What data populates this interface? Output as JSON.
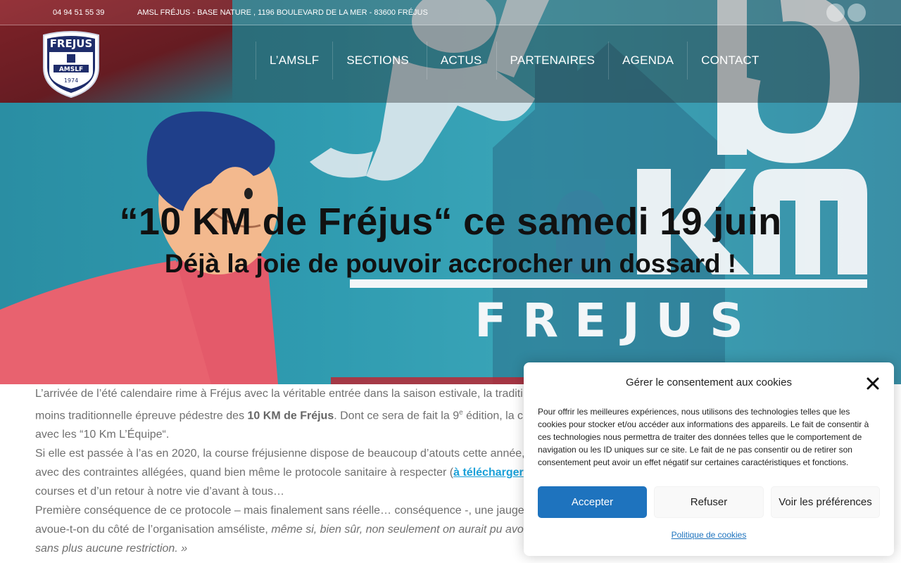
{
  "topbar": {
    "phone": "04 94 51 55 39",
    "address": "AMSL FRÉJUS - BASE NATURE , 1196 BOULEVARD DE LA MER - 83600 FRÉJUS"
  },
  "logo": {
    "top_text": "FREJUS",
    "mid_text": "AMSLF",
    "year": "1974"
  },
  "nav": {
    "items": [
      "L’AMSLF",
      "SECTIONS",
      "ACTUS",
      "PARTENAIRES",
      "AGENDA",
      "CONTACT"
    ]
  },
  "hero": {
    "title": "“10 KM de Fréjus“ ce samedi 19 juin",
    "subtitle": "Déjà la joie de pouvoir accrocher un dossard !",
    "poster_big": "10",
    "poster_km": "km",
    "poster_city": "F R E J U S"
  },
  "article": {
    "l1": "L’arrivée de l’été calendaire rime à Fréjus avec la véritable entrée dans la saison estivale, la traditi",
    "l2_a": "moins traditionnelle épreuve pédestre des ",
    "l2_b": "10 KM de Fréjus",
    "l2_c": ". Dont ce sera de fait la 9",
    "l2_sup": "e",
    "l2_d": " édition, la c",
    "l3": "avec les “10 Km L’Équipe“.",
    "l4": "Si elle est passée à l’as en 2020, la course fréjusienne dispose de beaucoup d’atouts cette année,",
    "l5_a": "avec des contraintes allégées, quand bien même le protocole sanitaire à respecter (",
    "l5_link": "à télécharger",
    "l6": "courses et d’un retour à notre vie d’avant à tous…",
    "l7": "Première conséquence de ce protocole – mais finalement sans réelle… conséquence -, une jauge",
    "l8_a": "avoue-t-on du côté de l’organisation amséliste, ",
    "l8_b": "même si, bien sûr, non seulement on aurait pu avo",
    "l9": "sans plus aucune restriction. »"
  },
  "cookie": {
    "title": "Gérer le consentement aux cookies",
    "text": "Pour offrir les meilleures expériences, nous utilisons des technologies telles que les cookies pour stocker et/ou accéder aux informations des appareils. Le fait de consentir à ces technologies nous permettra de traiter des données telles que le comportement de navigation ou les ID uniques sur ce site. Le fait de ne pas consentir ou de retirer son consentement peut avoir un effet négatif sur certaines caractéristiques et fonctions.",
    "accept": "Accepter",
    "refuse": "Refuser",
    "prefs": "Voir les préférences",
    "policy": "Politique de cookies"
  },
  "colors": {
    "accent_blue": "#1e73be",
    "hero_teal": "#2f9bb0",
    "brand_red": "#b51f29",
    "logo_navy": "#1f2d6b"
  }
}
